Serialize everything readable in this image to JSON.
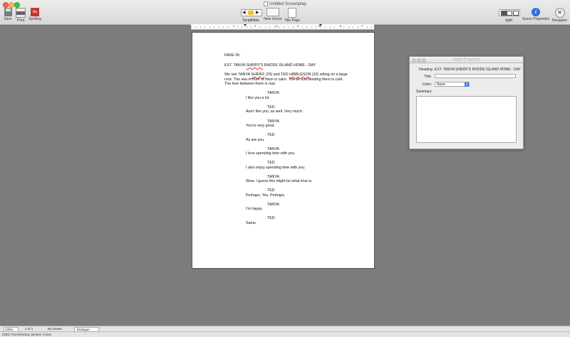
{
  "window": {
    "title": "Untitled Screenplay"
  },
  "toolbar": {
    "save_label": "Save",
    "print_label": "Print",
    "spelling_label": "Spelling",
    "scriptnote_label": "ScriptNote",
    "new_scene_label": "New Scene",
    "title_page_label": "Title Page",
    "split_label": "Split",
    "scene_properties_label": "Scene Properties",
    "navigator_label": "Navigator",
    "prev_glyph": "◀",
    "next_glyph": "▶",
    "spelling_glyph": "Aa",
    "info_glyph": "i",
    "compass_glyph": "✕"
  },
  "ruler": {
    "numbers": [
      "1",
      "2",
      "3",
      "4",
      "5",
      "6",
      "7"
    ]
  },
  "script": {
    "transition": "FADE IN:",
    "heading_a": "EXT. TANYA ",
    "heading_b": "SHRIFF'S",
    "heading_c": " RHODE ISLAND HOME - DAY",
    "action_line1_a": "We see TANYA ",
    "action_line1_b": "SHRIFF",
    "action_line1_c": " (25) and TED ",
    "action_line1_d": "HIBBLESON",
    "action_line1_e": " (32) sitting on a large",
    "action_line2": "rock. The sea in front of them is calm. The air surrounding them is cold.",
    "action_line3": "The love between them is real.",
    "exchanges": [
      {
        "character": "TANYA",
        "line": "I like you a lot."
      },
      {
        "character": "TED",
        "line": "And I like you, as well. Very much."
      },
      {
        "character": "TANYA",
        "line": "You're very good."
      },
      {
        "character": "TED",
        "line": "As are you."
      },
      {
        "character": "TANYA",
        "line": "I love spending time with you."
      },
      {
        "character": "TED",
        "line": "I also enjoy spending time with you."
      },
      {
        "character": "TANYA",
        "line": "Wow. I guess this might be what love is."
      },
      {
        "character": "TED",
        "line": "Perhaps. Yes. Perhaps."
      },
      {
        "character": "TANYA",
        "line": "I'm happy."
      },
      {
        "character": "TED",
        "line": "Same."
      }
    ]
  },
  "scene_properties": {
    "title": "Scene Properties",
    "heading_label": "Heading:",
    "heading_value": "EXT. TANYA SHRIFF'S RHODE ISLAND HOME - DAY",
    "title_label": "Title:",
    "title_value": "",
    "color_label": "Color:",
    "color_value": "None",
    "summary_label": "Summary:"
  },
  "status": {
    "zoom": "100%",
    "page_count": "1   of  1",
    "scene": "No Scene",
    "element": "Dialogue",
    "hint": "[Tab]: Parenthetical, [Enter]: Action"
  },
  "colors": {
    "accent": "#2f6fd8",
    "misspell": "#dd3333",
    "workspace": "#7c7c7c"
  }
}
